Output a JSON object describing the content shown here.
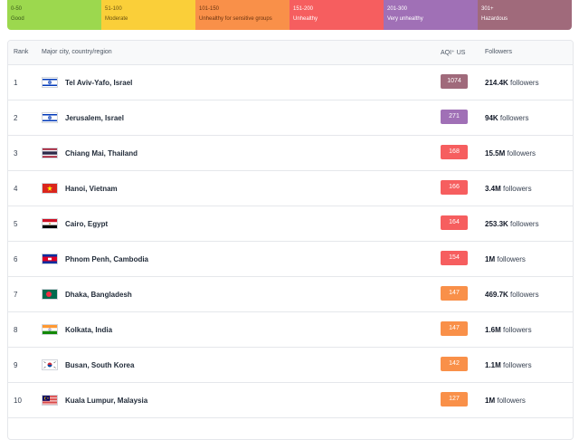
{
  "legend": [
    {
      "range": "0-50",
      "label": "Good",
      "color": "#9cd84e",
      "text": "#3a5a1a"
    },
    {
      "range": "51-100",
      "label": "Moderate",
      "color": "#facf39",
      "text": "#6b5210"
    },
    {
      "range": "101-150",
      "label": "Unhealthy for sensitive groups",
      "color": "#f99049",
      "text": "#6b3410"
    },
    {
      "range": "151-200",
      "label": "Unhealthy",
      "color": "#f65e5f",
      "text": "#ffffff"
    },
    {
      "range": "201-300",
      "label": "Very unhealthy",
      "color": "#a070b6",
      "text": "#ffffff"
    },
    {
      "range": "301+",
      "label": "Hazardous",
      "color": "#a06a7b",
      "text": "#ffffff"
    }
  ],
  "table": {
    "headers": {
      "rank": "Rank",
      "city": "Major city, country/region",
      "aqi": "AQI⁺ US",
      "followers": "Followers"
    },
    "rows": [
      {
        "rank": "1",
        "city": "Tel Aviv-Yafo, Israel",
        "aqi": "1074",
        "aqi_color": "#a06a7b",
        "followers_num": "214.4K",
        "followers_text": " followers",
        "flag": "israel-flag"
      },
      {
        "rank": "2",
        "city": "Jerusalem, Israel",
        "aqi": "271",
        "aqi_color": "#a070b6",
        "followers_num": "94K",
        "followers_text": " followers",
        "flag": "israel-flag"
      },
      {
        "rank": "3",
        "city": "Chiang Mai, Thailand",
        "aqi": "168",
        "aqi_color": "#f65e5f",
        "followers_num": "15.5M",
        "followers_text": " followers",
        "flag": "thailand-flag"
      },
      {
        "rank": "4",
        "city": "Hanoi, Vietnam",
        "aqi": "166",
        "aqi_color": "#f65e5f",
        "followers_num": "3.4M",
        "followers_text": " followers",
        "flag": "vietnam-flag"
      },
      {
        "rank": "5",
        "city": "Cairo, Egypt",
        "aqi": "164",
        "aqi_color": "#f65e5f",
        "followers_num": "253.3K",
        "followers_text": " followers",
        "flag": "egypt-flag"
      },
      {
        "rank": "6",
        "city": "Phnom Penh, Cambodia",
        "aqi": "154",
        "aqi_color": "#f65e5f",
        "followers_num": "1M",
        "followers_text": " followers",
        "flag": "cambodia-flag"
      },
      {
        "rank": "7",
        "city": "Dhaka, Bangladesh",
        "aqi": "147",
        "aqi_color": "#f99049",
        "followers_num": "469.7K",
        "followers_text": " followers",
        "flag": "bangladesh-flag"
      },
      {
        "rank": "8",
        "city": "Kolkata, India",
        "aqi": "147",
        "aqi_color": "#f99049",
        "followers_num": "1.6M",
        "followers_text": " followers",
        "flag": "india-flag"
      },
      {
        "rank": "9",
        "city": "Busan, South Korea",
        "aqi": "142",
        "aqi_color": "#f99049",
        "followers_num": "1.1M",
        "followers_text": " followers",
        "flag": "south-korea-flag"
      },
      {
        "rank": "10",
        "city": "Kuala Lumpur, Malaysia",
        "aqi": "127",
        "aqi_color": "#f99049",
        "followers_num": "1M",
        "followers_text": " followers",
        "flag": "malaysia-flag"
      }
    ]
  }
}
